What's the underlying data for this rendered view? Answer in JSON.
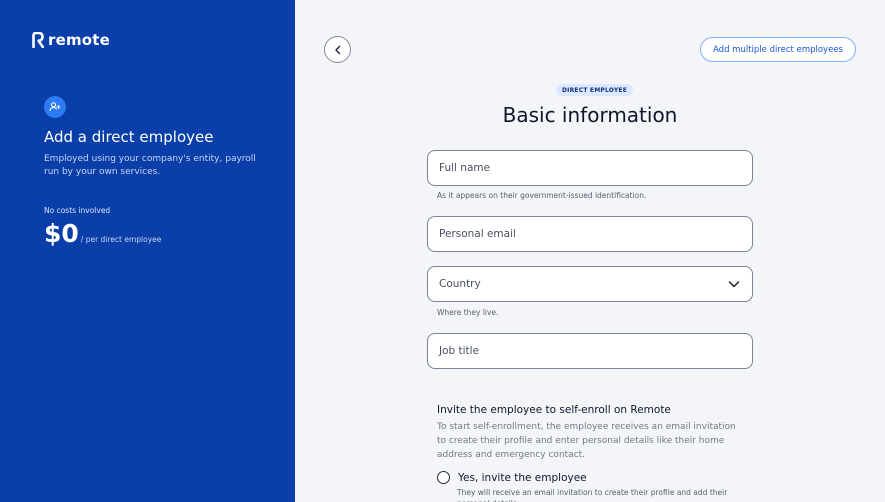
{
  "brand": {
    "name": "remote"
  },
  "sidebar": {
    "title": "Add a direct employee",
    "description": "Employed using your company's entity, payroll run by your own services.",
    "cost_label": "No costs involved",
    "price": "$0",
    "price_unit": "/ per direct employee"
  },
  "header": {
    "multi_button": "Add multiple direct employees"
  },
  "form": {
    "badge": "DIRECT EMPLOYEE",
    "heading": "Basic information",
    "full_name": {
      "label": "Full name",
      "help": "As it appears on their government-issued identification."
    },
    "email": {
      "label": "Personal email"
    },
    "country": {
      "label": "Country",
      "help": "Where they live."
    },
    "job_title": {
      "label": "Job title"
    },
    "invite": {
      "title": "Invite the employee to self-enroll on Remote",
      "description": "To start self-enrollment, the employee receives an email invitation to create their profile and enter personal details like their home address and emergency contact.",
      "option_yes": "Yes, invite the employee",
      "option_yes_desc": "They will receive an email invitation to create their profile and add their personal details."
    }
  },
  "colors": {
    "sidebar_bg": "#0a3ea8",
    "accent": "#1a55d6",
    "badge_bg": "#dce8ff"
  }
}
